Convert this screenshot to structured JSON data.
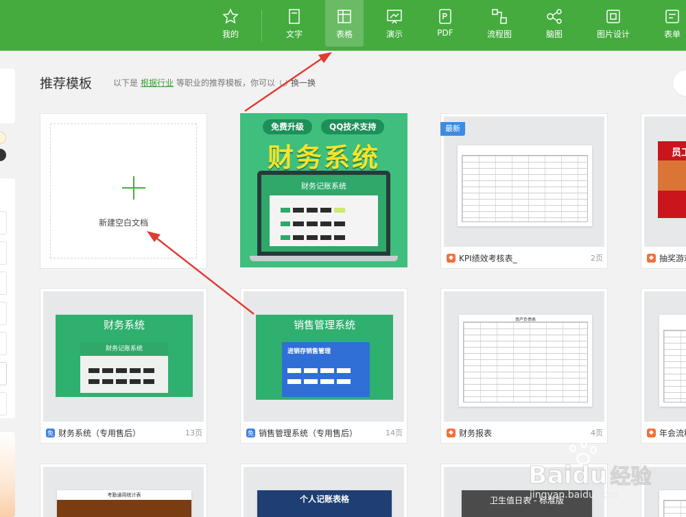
{
  "nav": {
    "items": [
      {
        "label": "我的",
        "icon": "star-icon"
      },
      {
        "label": "文字",
        "icon": "document-icon"
      },
      {
        "label": "表格",
        "icon": "table-icon",
        "active": true
      },
      {
        "label": "演示",
        "icon": "presentation-icon"
      },
      {
        "label": "PDF",
        "icon": "pdf-icon"
      },
      {
        "label": "流程图",
        "icon": "flowchart-icon"
      },
      {
        "label": "脑图",
        "icon": "mindmap-icon"
      },
      {
        "label": "图片设计",
        "icon": "image-design-icon"
      },
      {
        "label": "表单",
        "icon": "form-icon"
      }
    ],
    "accent": "#45ab3f"
  },
  "section": {
    "title": "推荐模板",
    "sub_prefix": "以下是",
    "sub_link": "根据行业",
    "sub_suffix": "等职业的推荐模板，你可以",
    "refresh": "换一换"
  },
  "blank_card": {
    "label": "新建空白文档"
  },
  "promo": {
    "pill_left": "免费升级",
    "pill_right": "QQ技术支持",
    "headline": "财务系统",
    "screen_title": "财务记账系统"
  },
  "cards": [
    {
      "title": "KPI绩效考核表_",
      "pages": "2页",
      "badge": "new",
      "badge_label": "最新"
    },
    {
      "title": "抽奖游戏",
      "pages": ""
    },
    {
      "title": "财务系统（专用售后）",
      "pages": "13页",
      "free": "免",
      "thumb_title": "财务系统",
      "thumb_sub": "财务记账系统"
    },
    {
      "title": "销售管理系统（专用售后）",
      "pages": "14页",
      "free": "免",
      "thumb_title": "销售管理系统",
      "thumb_sub": "进销存销售管理"
    },
    {
      "title": "财务报表",
      "pages": "4页",
      "thumb_title": "资产负债表"
    },
    {
      "title": "年会流程",
      "pages": ""
    },
    {
      "thumb_title": "考勤通用统计表"
    },
    {
      "thumb_title": "个人记账表格"
    },
    {
      "thumb_title": "卫生值日表 - 标准版"
    }
  ],
  "card4_thumb": {
    "title": "员工"
  },
  "watermark": {
    "brand": "Baidu",
    "brand_cn": "经验",
    "url": "jingyan.baidu.com"
  }
}
